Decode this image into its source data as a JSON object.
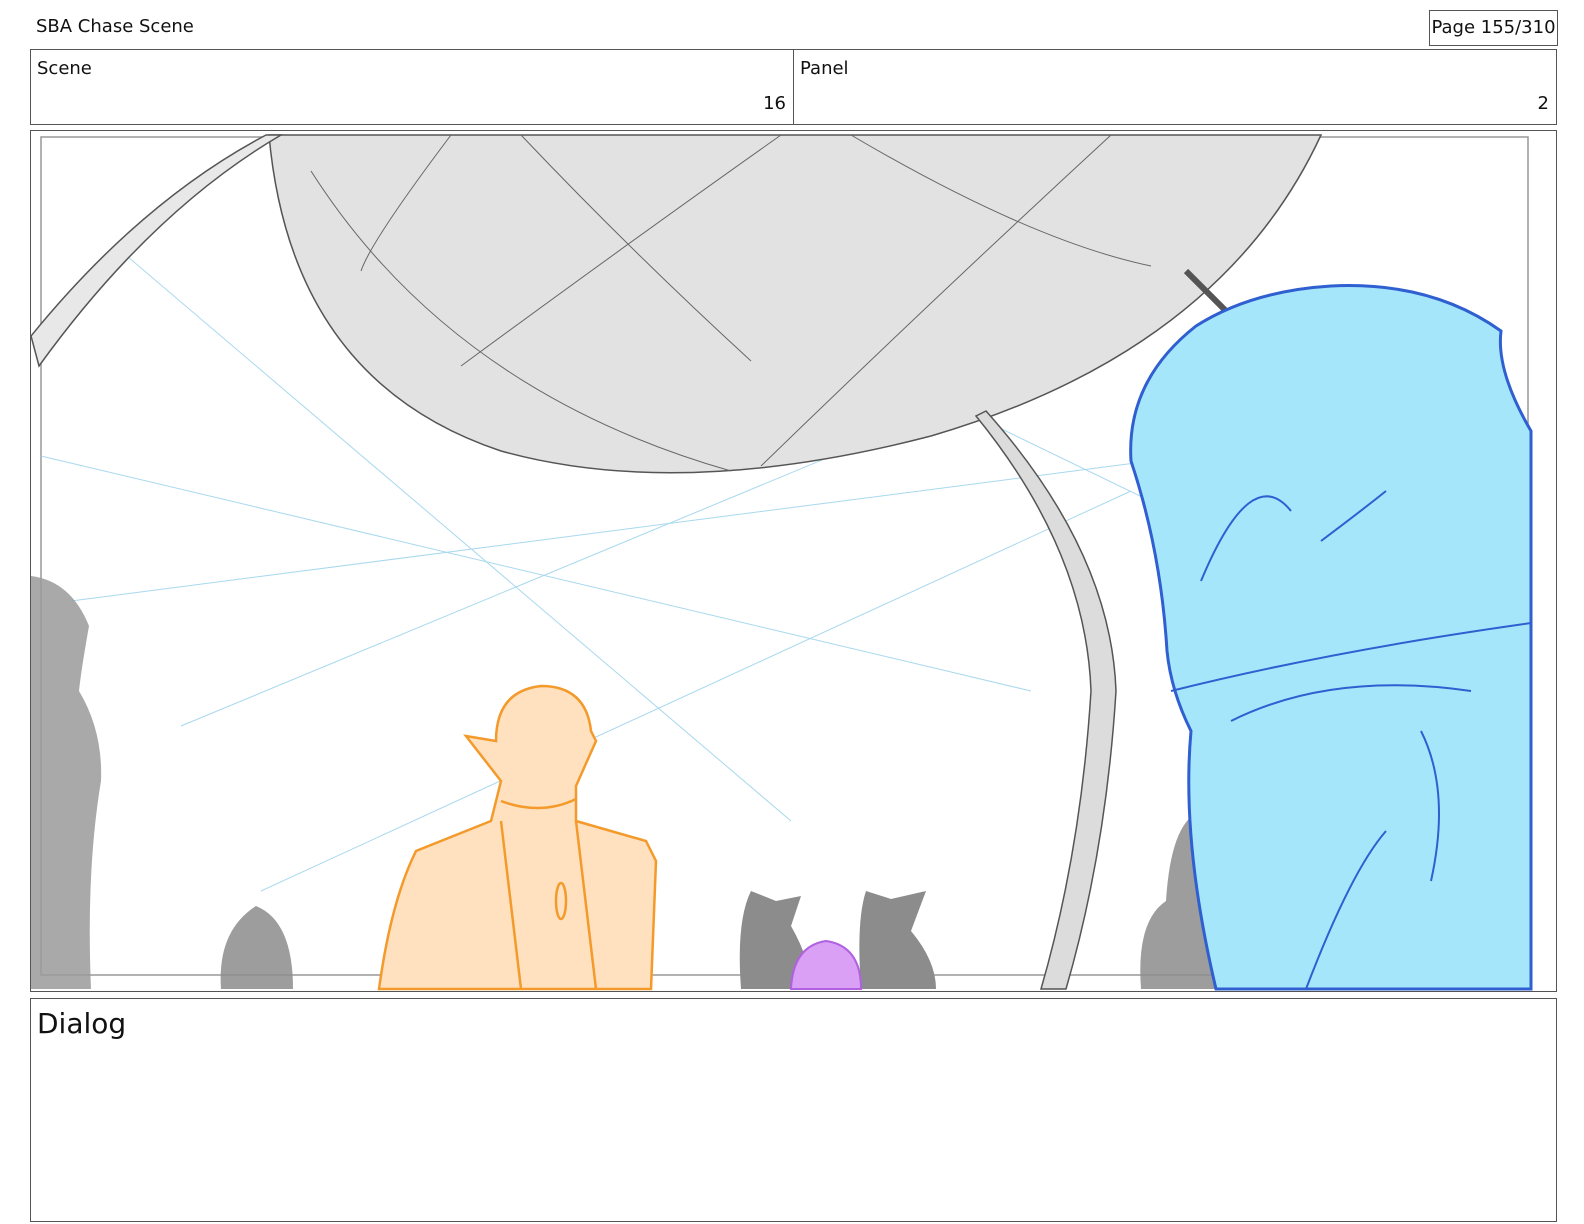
{
  "header": {
    "project_title": "SBA Chase Scene",
    "page_label": "Page 155/310"
  },
  "info": {
    "scene_label": "Scene",
    "scene_value": "16",
    "panel_label": "Panel",
    "panel_value": "2"
  },
  "panel_image": {
    "description_icon": "storyboard-sketch",
    "colors": {
      "dome": "#e2e2e2",
      "hooded_figure": "#a6e6fb",
      "hooded_outline": "#2f5fd0",
      "elf_fill": "#ffe0bf",
      "elf_line": "#f39a2b",
      "crowd": "#8c8c8c",
      "purple_head": "#d9a0f5",
      "guide_lines": "#a8d8ee"
    }
  },
  "dialog": {
    "label": "Dialog",
    "text": ""
  }
}
